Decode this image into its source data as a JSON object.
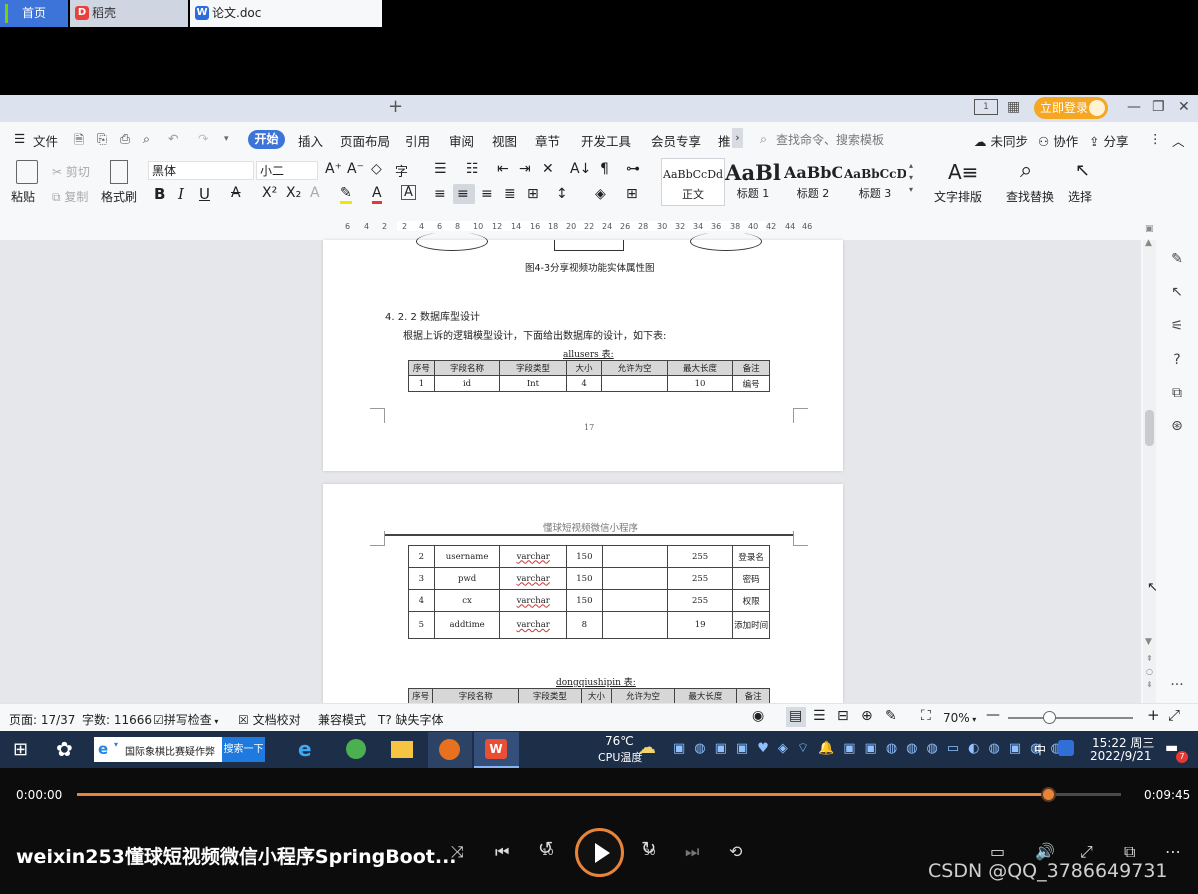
{
  "tabs": {
    "home": "首页",
    "daoke": "稻壳",
    "doc": "论文.doc",
    "new": "+",
    "login": "立即登录"
  },
  "menu": {
    "file": "文件",
    "items": [
      "开始",
      "插入",
      "页面布局",
      "引用",
      "审阅",
      "视图",
      "章节",
      "开发工具",
      "会员专享",
      "推"
    ],
    "more": "›",
    "search_placeholder": "查找命令、搜索模板",
    "right": [
      "未同步",
      "协作",
      "分享"
    ]
  },
  "ribbon": {
    "paste": "粘贴",
    "cut": "剪切",
    "copy": "复制",
    "format_painter": "格式刷",
    "font_name": "黑体",
    "font_size": "小二",
    "styles": [
      {
        "sample": "AaBbCcDd",
        "name": "正文"
      },
      {
        "sample": "AaBl",
        "name": "标题 1"
      },
      {
        "sample": "AaBbC",
        "name": "标题 2"
      },
      {
        "sample": "AaBbCcD",
        "name": "标题 3"
      }
    ],
    "text_layout": "文字排版",
    "find_replace": "查找替换",
    "select": "选择"
  },
  "ruler": [
    "6",
    "4",
    "2",
    "2",
    "4",
    "6",
    "8",
    "10",
    "12",
    "14",
    "16",
    "18",
    "20",
    "22",
    "24",
    "26",
    "28",
    "30",
    "32",
    "34",
    "36",
    "38",
    "40",
    "42",
    "44",
    "46"
  ],
  "document": {
    "fig_caption": "图4-3分享视频功能实体属性图",
    "section_heading": "4. 2. 2  数据库型设计",
    "intro": "根据上诉的逻辑模型设计，下面给出数据库的设计，如下表:",
    "table1_title": "allusers 表:",
    "headers": [
      "序号",
      "字段名称",
      "字段类型",
      "大小",
      "允许为空",
      "最大长度",
      "备注"
    ],
    "table1_rows": [
      [
        "1",
        "id",
        "Int",
        "4",
        "",
        "10",
        "编号"
      ]
    ],
    "page_number": "17",
    "page2_header": "懂球短视频微信小程序",
    "table1_cont_rows": [
      [
        "2",
        "username",
        "varchar",
        "150",
        "",
        "255",
        "登录名"
      ],
      [
        "3",
        "pwd",
        "varchar",
        "150",
        "",
        "255",
        "密码"
      ],
      [
        "4",
        "cx",
        "varchar",
        "150",
        "",
        "255",
        "权限"
      ],
      [
        "5",
        "addtime",
        "varchar",
        "8",
        "",
        "19",
        "添加时间"
      ]
    ],
    "table2_title": "dongqiushipin 表:"
  },
  "status": {
    "page": "页面: 17/37",
    "words": "字数: 11666",
    "spell": "拼写检查",
    "proof": "文档校对",
    "compat": "兼容模式",
    "missing_font": "缺失字体",
    "zoom": "70%"
  },
  "taskbar": {
    "ie_title": "国际象棋比赛疑作弊",
    "search_btn": "搜索一下",
    "weather_temp": "76℃",
    "weather_label": "CPU温度",
    "ime": "中",
    "time": "15:22 周三",
    "date": "2022/9/21",
    "notif": "7"
  },
  "player": {
    "current_time": "0:00:00",
    "total_time": "0:09:45",
    "progress": 0.93,
    "title": "weixin253懂球短视频微信小程序SpringBoot...",
    "skip_back": "10",
    "skip_fwd": "30",
    "watermark": "CSDN @QQ_3786649731"
  },
  "colors": {
    "accent_blue": "#3d74d9",
    "player_orange": "#e8833a",
    "login_orange": "#f5a623"
  }
}
